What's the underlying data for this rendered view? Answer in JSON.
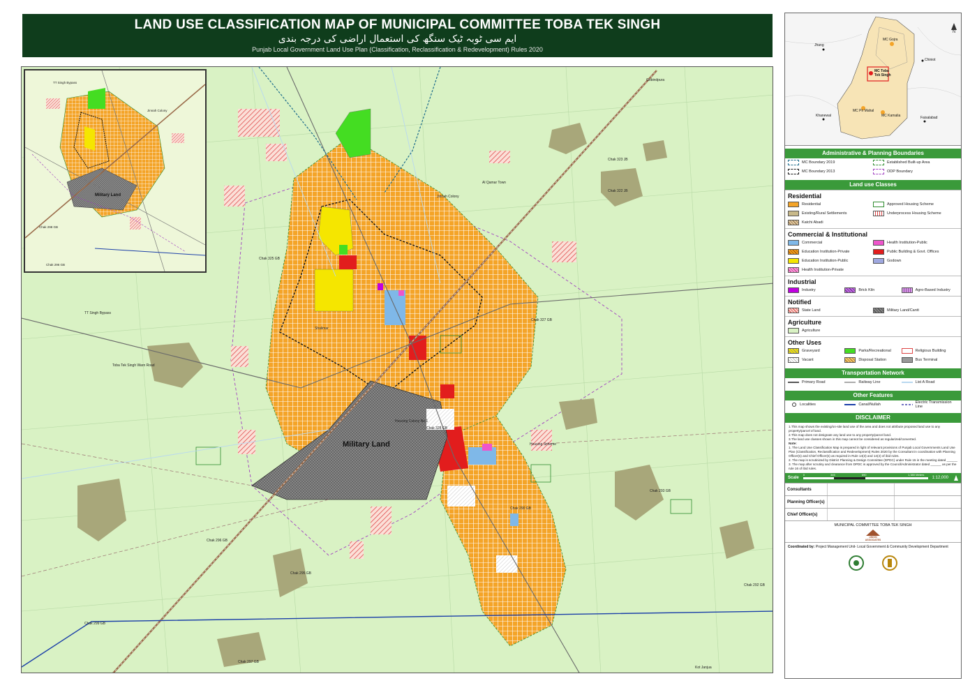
{
  "title": {
    "english": "LAND USE CLASSIFICATION MAP OF MUNICIPAL COMMITTEE TOBA TEK SINGH",
    "urdu": "ایم سی ٹوبہ ٹیک سنگھ کی استعمال اراضی کی درجہ بندی",
    "subtitle": "Punjab Local Government Land Use Plan (Classification, Reclassification & Redevelopment) Rules 2020"
  },
  "main_map": {
    "labels": {
      "military_land": "Military Land",
      "jinnah_colony": "Jinnah Colony",
      "chak_322_jb": "Chak 322 JB",
      "chak_323_jb": "Chak 323 JB",
      "chak_328_gb": "Chak 328 GB",
      "chak_327_gb": "Chak 327 GB",
      "chak_290_gb": "Chak 290 GB",
      "chak_293_gb": "Chak 293 GB",
      "chak_292_gb": "Chak 292 GB",
      "chak_296_gb": "Chak 296 GB",
      "chak_295_gb": "Chak 295 GB",
      "chak_299_gb": "Chak 299 GB",
      "chak_297_gb": "Chak 297 GB",
      "chak_325_gb": "Chak 325 GB",
      "kot_janjua": "Kot Janjua",
      "tt_singh_bypass": "TT Singh Bypass",
      "toba_tek_singh_road": "Toba Tek Singh Warn Road",
      "gobindpura": "Gobindpura",
      "housing_colony_no_1": "Housing Colony No.1",
      "housing_scheme": "Housing Scheme",
      "shalimar": "Shalimar",
      "al_qamar": "Al Qamar Town"
    }
  },
  "inset_map": {
    "labels": {
      "military_land": "Military Land",
      "tt_singh_bypass": "TT Singh Bypass",
      "chak_298_gb": "Chak 298 GB",
      "chak_296_gb": "Chak 296 GB",
      "jinnah_colony": "Jinnah Colony"
    }
  },
  "locator": {
    "places": {
      "jhang": "Jhang",
      "mc_gojra": "MC Gojra",
      "chiniot": "Chiniot",
      "mc_tts": "MC Toba Tek Singh",
      "khanewal": "Khanewal",
      "mc_pir_mahal": "MC Pir Mahal",
      "mc_kamalia": "MC Kamalia",
      "faisalabad": "Faisalabad"
    },
    "north": "N"
  },
  "legend": {
    "admin_head": "Administrative & Planning Boundaries",
    "admin": [
      {
        "label": "MC Boundary 2019",
        "color": "#1a6a8a"
      },
      {
        "label": "Established Built-up Area",
        "color": "#2e8b2e"
      },
      {
        "label": "MC Boundary 2013",
        "color": "#111111"
      },
      {
        "label": "ODP Boundary",
        "color": "#a040c0"
      }
    ],
    "landuse_head": "Land use Classes",
    "residential_head": "Residential",
    "residential": [
      {
        "label": "Residential",
        "color": "#f4a428"
      },
      {
        "label": "Approved Housing Scheme",
        "color": "#ffffff"
      },
      {
        "label": "Existing/Rural Settlements",
        "color": "#c8b98a"
      },
      {
        "label": "Underprocess Housing Scheme",
        "color": "#ffffff"
      },
      {
        "label": "Katchi Abadi",
        "color": "#e0c8a0"
      }
    ],
    "commercial_head": "Commercial & Institutional",
    "commercial": [
      {
        "label": "Commercial",
        "color": "#7fb8e8"
      },
      {
        "label": "Health Institution-Public",
        "color": "#ee55cc"
      },
      {
        "label": "Education Institution-Private",
        "color": "#f0a020"
      },
      {
        "label": "Public Building & Govt. Offices",
        "color": "#e21d1d"
      },
      {
        "label": "Education Institution-Public",
        "color": "#f5e600"
      },
      {
        "label": "Godown",
        "color": "#9fa8e0"
      },
      {
        "label": "Health Institution-Private",
        "color": "#f8a0d8"
      }
    ],
    "industrial_head": "Industrial",
    "industrial": [
      {
        "label": "Industry",
        "color": "#c000e0"
      },
      {
        "label": "Brick Kiln",
        "color": "#c070e0"
      },
      {
        "label": "Agro-Based Industry",
        "color": "#d8a0e8"
      }
    ],
    "notified_head": "Notified",
    "notified": [
      {
        "label": "State Land",
        "color": "#f8d0c8"
      },
      {
        "label": "Military Land/Cantt",
        "color": "#888888"
      }
    ],
    "agriculture_head": "Agriculture",
    "agriculture": [
      {
        "label": "Agriculture",
        "color": "#d9f2c4"
      }
    ],
    "other_head": "Other Uses",
    "other": [
      {
        "label": "Graveyard",
        "color": "#f5e600"
      },
      {
        "label": "Parks/Recreational",
        "color": "#44dd22"
      },
      {
        "label": "Religious Building",
        "color": "#ffffff"
      },
      {
        "label": "Vacant",
        "color": "#ffffff"
      },
      {
        "label": "Disposal Station",
        "color": "#f4c870"
      },
      {
        "label": "Bus Terminal",
        "color": "#999999"
      }
    ],
    "transport_head": "Transportation Network",
    "transport": [
      {
        "label": "Primary Road",
        "color": "#555555"
      },
      {
        "label": "Railway Line",
        "color": "#aaaaaa"
      },
      {
        "label": "List A Road",
        "color": "#b8d8f0"
      }
    ],
    "features_head": "Other Features",
    "features": [
      {
        "label": "Localities",
        "color": "#333333"
      },
      {
        "label": "Canal/Nullah",
        "color": "#1a3ea8"
      },
      {
        "label": "Electric Transmission Line",
        "color": "#7070c0"
      }
    ]
  },
  "disclaimer": {
    "head": "DISCLAIMER",
    "lines": [
      "1.This map shows the existing/on-site land use of the area and does not attribute proposed land use to any property/parcel of land.",
      "2.This map does not designate any land use to any property/parcel land.",
      "3.The land use classes shown in this map cannot be considered as regularized/converted."
    ],
    "note_head": "Note:",
    "notes": [
      "1. The Land Use Classification Map is prepared in light of relevant provisions of Punjab Local Governments Land Use Plan (Classification, Reclassification and Redevelopment) Rules 2020 by the Consultant in coordination with Planning Officer(s) and Chief Officer(s) as required in Rule 14(3) and 14(4) of ibid rules.",
      "2. The map is scrutinized by District Planning & Design Committee (DPDC) under Rule 15 in the meeting dated ______",
      "3. The map after scrutiny and clearance from DPDC is approved by the Council/Administrator dated ______ as per the rule 16 of ibid rules."
    ]
  },
  "scale": {
    "label": "Scale",
    "ticks": [
      "0",
      "345",
      "690",
      "1,380 Meters"
    ],
    "ratio": "1:12,000"
  },
  "signatures": {
    "consultants": "Consultants",
    "planning": "Planning Officer(s)",
    "chief": "Chief Officer(s)"
  },
  "footer": {
    "mc_name": "MUNICIPAL COMMITTEE TOBA TEK SINGH",
    "logo_text": "UNION ASSOCIATES",
    "coordinated_by_label": "Coordinated by:",
    "coordinated_by": "Project Management Unit- Local Government & Community Development Department"
  }
}
